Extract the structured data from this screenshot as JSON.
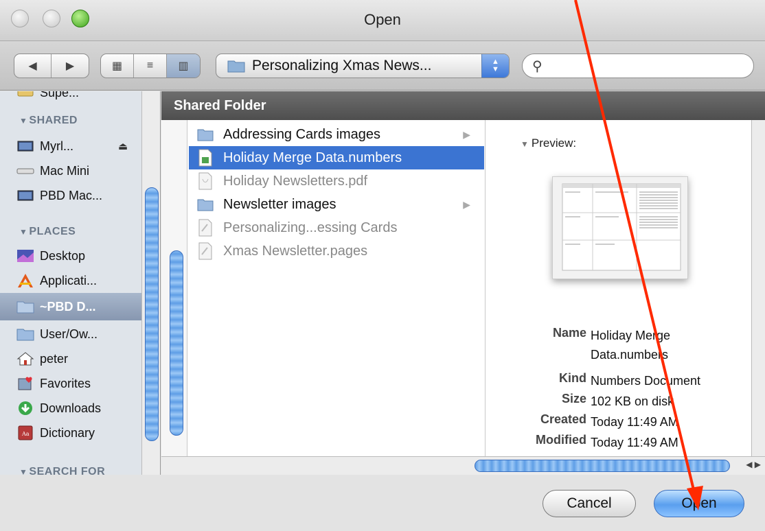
{
  "window": {
    "title": "Open"
  },
  "toolbar": {
    "back_glyph": "◀",
    "forward_glyph": "▶",
    "view_icon_glyph": "▦",
    "view_list_glyph": "≡",
    "view_column_glyph": "▥",
    "location": "Personalizing Xmas News...",
    "search_placeholder": ""
  },
  "sidebar": {
    "partial_top": "Supe...",
    "sections": [
      {
        "label": "SHARED"
      },
      {
        "label": "PLACES"
      },
      {
        "label": "SEARCH FOR"
      }
    ],
    "shared_items": [
      {
        "label": "Myrl...",
        "icon": "display-icon",
        "eject": true
      },
      {
        "label": "Mac Mini",
        "icon": "mac-mini-icon"
      },
      {
        "label": "PBD Mac...",
        "icon": "display-icon"
      }
    ],
    "place_items": [
      {
        "label": "Desktop",
        "icon": "desktop-icon"
      },
      {
        "label": "Applicati...",
        "icon": "applications-icon"
      },
      {
        "label": "~PBD D...",
        "icon": "folder-icon",
        "selected": true
      },
      {
        "label": "User/Ow...",
        "icon": "folder-icon"
      },
      {
        "label": "peter",
        "icon": "home-icon"
      },
      {
        "label": "Favorites",
        "icon": "favorites-icon"
      },
      {
        "label": "Downloads",
        "icon": "downloads-icon"
      },
      {
        "label": "Dictionary",
        "icon": "dictionary-icon"
      }
    ]
  },
  "browser": {
    "header": "Shared Folder",
    "files": [
      {
        "name": "Addressing Cards images",
        "type": "folder",
        "has_children": true
      },
      {
        "name": "Holiday Merge Data.numbers",
        "type": "numbers",
        "selected": true
      },
      {
        "name": "Holiday Newsletters.pdf",
        "type": "pdf",
        "dimmed": true
      },
      {
        "name": "Newsletter images",
        "type": "folder",
        "has_children": true
      },
      {
        "name": "Personalizing...essing Cards",
        "type": "doc",
        "dimmed": true
      },
      {
        "name": "Xmas Newsletter.pages",
        "type": "doc",
        "dimmed": true
      }
    ],
    "preview": {
      "label": "Preview:",
      "info": [
        {
          "key": "Name",
          "value": "Holiday Merge Data.numbers"
        },
        {
          "key": "Kind",
          "value": "Numbers Document"
        },
        {
          "key": "Size",
          "value": "102 KB on disk"
        },
        {
          "key": "Created",
          "value": "Today 11:49 AM"
        },
        {
          "key": "Modified",
          "value": "Today 11:49 AM"
        }
      ]
    }
  },
  "buttons": {
    "cancel": "Cancel",
    "open": "Open"
  },
  "colors": {
    "selection": "#3b74d2",
    "annotation_arrow": "#ff2a00"
  }
}
